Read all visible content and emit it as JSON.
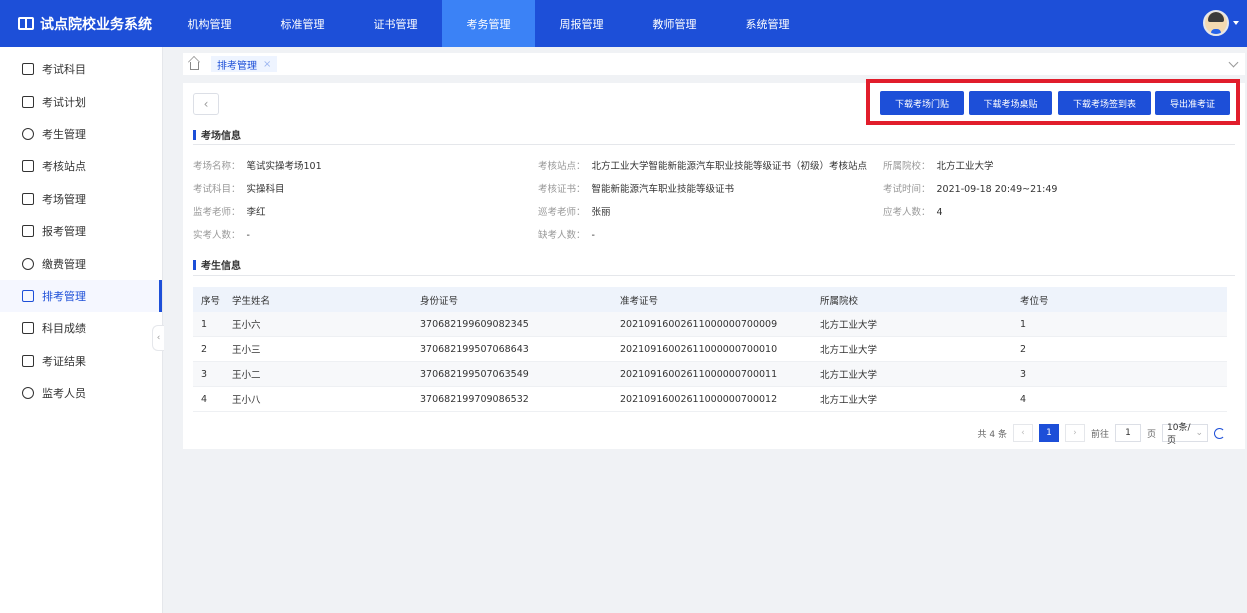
{
  "app": {
    "title": "试点院校业务系统"
  },
  "topnav": [
    {
      "label": "机构管理"
    },
    {
      "label": "标准管理"
    },
    {
      "label": "证书管理"
    },
    {
      "label": "考务管理",
      "active": true
    },
    {
      "label": "周报管理"
    },
    {
      "label": "教师管理"
    },
    {
      "label": "系统管理"
    }
  ],
  "sidebar": [
    {
      "label": "考试科目"
    },
    {
      "label": "考试计划"
    },
    {
      "label": "考生管理"
    },
    {
      "label": "考核站点"
    },
    {
      "label": "考场管理"
    },
    {
      "label": "报考管理"
    },
    {
      "label": "缴费管理"
    },
    {
      "label": "排考管理",
      "active": true
    },
    {
      "label": "科目成绩"
    },
    {
      "label": "考证结果"
    },
    {
      "label": "监考人员"
    }
  ],
  "tabs": {
    "current": "排考管理"
  },
  "actions": {
    "btn1": "下载考场门贴",
    "btn2": "下载考场桌贴",
    "btn3": "下载考场签到表",
    "btn4": "导出准考证"
  },
  "room": {
    "title": "考场信息",
    "name_k": "考场名称：",
    "name_v": "笔试实操考场101",
    "site_k": "考核站点：",
    "site_v": "北方工业大学智能新能源汽车职业技能等级证书（初级）考核站点",
    "school_k": "所属院校：",
    "school_v": "北方工业大学",
    "subject_k": "考试科目：",
    "subject_v": "实操科目",
    "cert_k": "考核证书：",
    "cert_v": "智能新能源汽车职业技能等级证书",
    "time_k": "考试时间：",
    "time_v": "2021-09-18 20:49~21:49",
    "proctor_k": "监考老师：",
    "proctor_v": "李红",
    "inspector_k": "巡考老师：",
    "inspector_v": "张丽",
    "expected_k": "应考人数：",
    "expected_v": "4",
    "actual_k": "实考人数：",
    "actual_v": "-",
    "absent_k": "缺考人数：",
    "absent_v": "-"
  },
  "students": {
    "title": "考生信息",
    "headers": [
      "序号",
      "学生姓名",
      "身份证号",
      "准考证号",
      "所属院校",
      "考位号"
    ],
    "rows": [
      [
        "1",
        "王小六",
        "370682199609082345",
        "20210916002611000000700009",
        "北方工业大学",
        "1"
      ],
      [
        "2",
        "王小三",
        "370682199507068643",
        "20210916002611000000700010",
        "北方工业大学",
        "2"
      ],
      [
        "3",
        "王小二",
        "370682199507063549",
        "20210916002611000000700011",
        "北方工业大学",
        "3"
      ],
      [
        "4",
        "王小八",
        "370682199709086532",
        "20210916002611000000700012",
        "北方工业大学",
        "4"
      ]
    ]
  },
  "pager": {
    "total": "共 4 条",
    "current": "1",
    "goto_label": "前往",
    "goto_value": "1",
    "page_unit": "页",
    "page_size": "10条/页"
  }
}
